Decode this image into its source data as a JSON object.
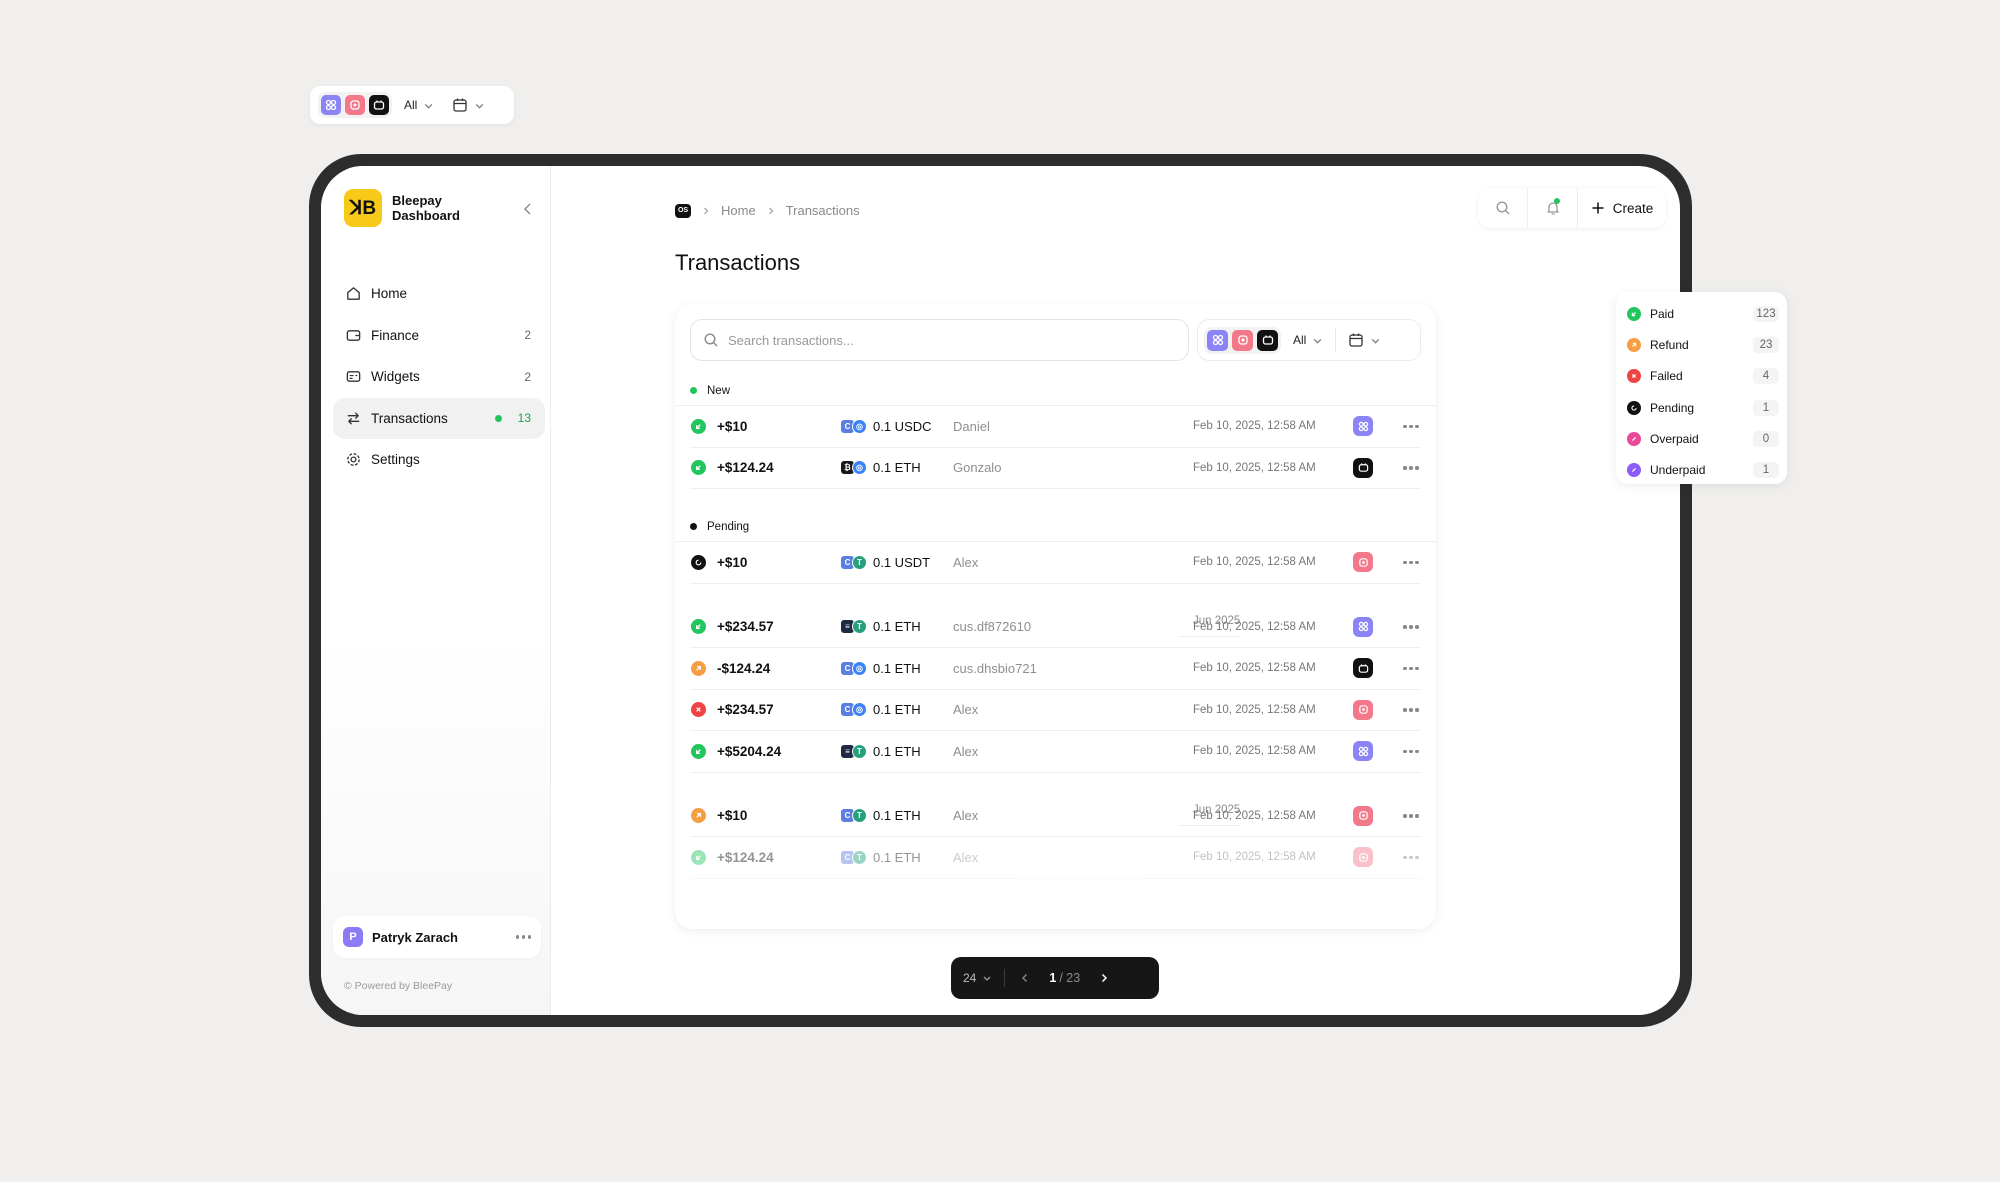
{
  "floating_filter": {
    "all_label": "All"
  },
  "brand": {
    "name_line1": "Bleepay",
    "name_line2": "Dashboard",
    "logo_text": "ꓘB"
  },
  "nav": [
    {
      "label": "Home",
      "count": ""
    },
    {
      "label": "Finance",
      "count": "2"
    },
    {
      "label": "Widgets",
      "count": "2"
    },
    {
      "label": "Transactions",
      "count": "13"
    },
    {
      "label": "Settings",
      "count": ""
    }
  ],
  "user": {
    "name": "Patryk Zarach",
    "initial": "P"
  },
  "powered_by": "© Powered by BleePay",
  "breadcrumb": {
    "badge": "OS",
    "home": "Home",
    "current": "Transactions"
  },
  "page_title": "Transactions",
  "topbar": {
    "create_label": "Create"
  },
  "search": {
    "placeholder": "Search transactions..."
  },
  "card_filter": {
    "all_label": "All"
  },
  "groups": [
    {
      "title": "New",
      "kind": "status",
      "dot_color": "#22c55e",
      "rows": [
        {
          "status": "paid",
          "amount": "+$10",
          "coin_label": "0.1 USDC",
          "coins": [
            "#5b7fe0",
            "#3b82f6"
          ],
          "coin_letters": [
            "C",
            "◎"
          ],
          "customer": "Daniel",
          "date": "Feb 10, 2025, 12:58 AM",
          "app": "purple"
        },
        {
          "status": "paid",
          "amount": "+$124.24",
          "coin_label": "0.1 ETH",
          "coins": [
            "#1a1a1a",
            "#3b82f6"
          ],
          "coin_letters": [
            "₿",
            "◎"
          ],
          "customer": "Gonzalo",
          "date": "Feb 10, 2025, 12:58 AM",
          "app": "black"
        }
      ]
    },
    {
      "title": "Pending",
      "kind": "status",
      "dot_color": "#111111",
      "rows": [
        {
          "status": "pending",
          "amount": "+$10",
          "coin_label": "0.1 USDT",
          "coins": [
            "#5b7fe0",
            "#26a17b"
          ],
          "coin_letters": [
            "C",
            "T"
          ],
          "customer": "Alex",
          "date": "Feb 10, 2025, 12:58 AM",
          "app": "pink"
        }
      ]
    },
    {
      "title": "Jun 2025",
      "kind": "date",
      "rows": [
        {
          "status": "paid",
          "amount": "+$234.57",
          "coin_label": "0.1 ETH",
          "coins": [
            "#1f2a44",
            "#26a17b"
          ],
          "coin_letters": [
            "≡",
            "T"
          ],
          "customer": "cus.df872610",
          "date": "Feb 10, 2025, 12:58 AM",
          "app": "purple"
        },
        {
          "status": "refund",
          "amount": "-$124.24",
          "coin_label": "0.1 ETH",
          "coins": [
            "#5b7fe0",
            "#3b82f6"
          ],
          "coin_letters": [
            "C",
            "◎"
          ],
          "customer": "cus.dhsbio721",
          "date": "Feb 10, 2025, 12:58 AM",
          "app": "black"
        },
        {
          "status": "failed",
          "amount": "+$234.57",
          "coin_label": "0.1 ETH",
          "coins": [
            "#5b7fe0",
            "#3b82f6"
          ],
          "coin_letters": [
            "C",
            "◎"
          ],
          "customer": "Alex",
          "date": "Feb 10, 2025, 12:58 AM",
          "app": "pink"
        },
        {
          "status": "paid",
          "amount": "+$5204.24",
          "coin_label": "0.1 ETH",
          "coins": [
            "#1f2a44",
            "#26a17b"
          ],
          "coin_letters": [
            "≡",
            "T"
          ],
          "customer": "Alex",
          "date": "Feb 10, 2025, 12:58 AM",
          "app": "purple"
        }
      ]
    },
    {
      "title": "Jun 2025",
      "kind": "date",
      "rows": [
        {
          "status": "refund",
          "amount": "+$10",
          "coin_label": "0.1 ETH",
          "coins": [
            "#5b7fe0",
            "#26a17b"
          ],
          "coin_letters": [
            "C",
            "T"
          ],
          "customer": "Alex",
          "date": "Feb 10, 2025, 12:58 AM",
          "app": "pink"
        },
        {
          "status": "paid",
          "amount": "+$124.24",
          "coin_label": "0.1 ETH",
          "coins": [
            "#5b7fe0",
            "#26a17b"
          ],
          "coin_letters": [
            "C",
            "T"
          ],
          "customer": "Alex",
          "date": "Feb 10, 2025, 12:58 AM",
          "app": "pink",
          "faded": true
        }
      ]
    }
  ],
  "pagination": {
    "page_size": "24",
    "current": "1",
    "total": "/ 23"
  },
  "status_legend": [
    {
      "key": "paid",
      "label": "Paid",
      "count": "123"
    },
    {
      "key": "refund",
      "label": "Refund",
      "count": "23"
    },
    {
      "key": "failed",
      "label": "Failed",
      "count": "4"
    },
    {
      "key": "pending",
      "label": "Pending",
      "count": "1"
    },
    {
      "key": "overpaid",
      "label": "Overpaid",
      "count": "0"
    },
    {
      "key": "underpaid",
      "label": "Underpaid",
      "count": "1"
    }
  ],
  "status_colors": {
    "paid": "#22c55e",
    "refund": "#f59e42",
    "failed": "#ef4444",
    "pending": "#111111",
    "overpaid": "#ec4899",
    "underpaid": "#8b5cf6"
  },
  "app_colors": {
    "purple": "#8b84f5",
    "pink": "#f3788a",
    "black": "#111111"
  }
}
